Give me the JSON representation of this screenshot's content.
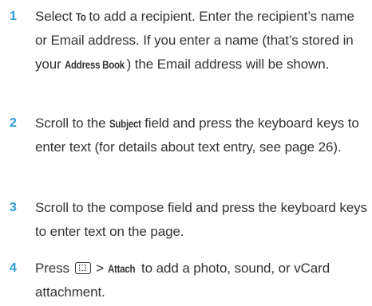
{
  "steps": [
    {
      "number": "1",
      "parts": {
        "a": "Select ",
        "to": "To",
        "b": " to add a recipient. Enter the recipient’s name or Email address. If you enter a name (that’s stored in your ",
        "address_book": "Address Book",
        "c": ") the Email address will be shown."
      }
    },
    {
      "number": "2",
      "parts": {
        "a": "Scroll to the ",
        "subject": "Subject",
        "b": " field and press the keyboard keys to enter text (for details about text entry, see page 26)."
      }
    },
    {
      "number": "3",
      "parts": {
        "a": "Scroll to the compose field and press the keyboard keys to enter text on the page."
      }
    },
    {
      "number": "4",
      "parts": {
        "a": "Press ",
        "menu_icon": "menu-key-icon",
        "b": " > ",
        "attach": "Attach",
        "c": " to add a photo, sound, or vCard attachment."
      }
    }
  ]
}
